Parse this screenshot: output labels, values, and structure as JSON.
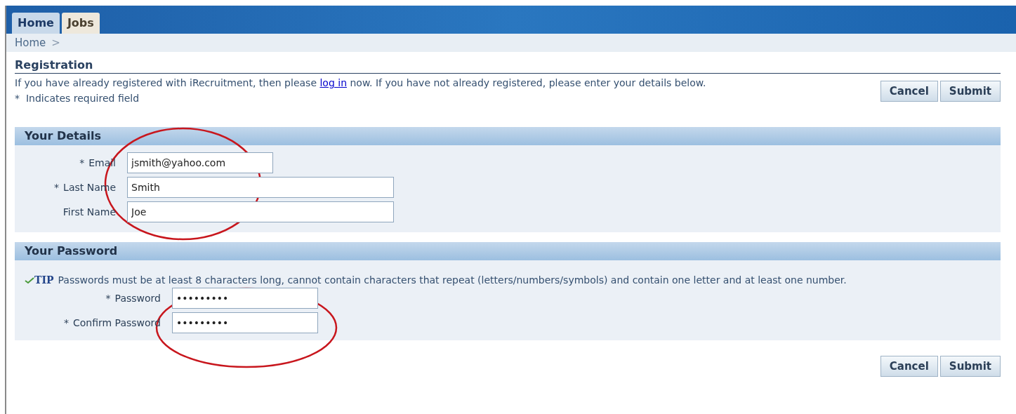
{
  "tabs": [
    {
      "label": "Home",
      "selected": true
    },
    {
      "label": "Jobs",
      "selected": false
    }
  ],
  "breadcrumb": {
    "items": [
      "Home"
    ],
    "separator": ">"
  },
  "page": {
    "title": "Registration",
    "intro_before": "If you have already registered with iRecruitment, then please ",
    "intro_link": "log in",
    "intro_after": " now. If you have not already registered, please enter your details below.",
    "required_note": "*  Indicates required field"
  },
  "required_marker": "*",
  "top_buttons": [
    "Cancel",
    "Submit"
  ],
  "sections": [
    {
      "title": "Your Details",
      "fields": [
        {
          "label": "Email",
          "required": true,
          "value": "jsmith@yahoo.com",
          "kind": "short"
        },
        {
          "label": "Last Name",
          "required": true,
          "value": "Smith",
          "kind": "long"
        },
        {
          "label": "First Name",
          "required": false,
          "value": "Joe",
          "kind": "long"
        }
      ]
    },
    {
      "title": "Your Password",
      "tip": {
        "label": "TIP",
        "text": "Passwords must be at least 8 characters long, cannot contain characters that repeat (letters/numbers/symbols) and contain one letter and at least one number."
      },
      "fields": [
        {
          "label": "Password",
          "required": true,
          "value": "•••••••••",
          "kind": "short"
        },
        {
          "label": "Confirm Password",
          "required": true,
          "value": "•••••••••",
          "kind": "short"
        }
      ]
    }
  ],
  "bottom_buttons": [
    "Cancel",
    "Submit"
  ]
}
